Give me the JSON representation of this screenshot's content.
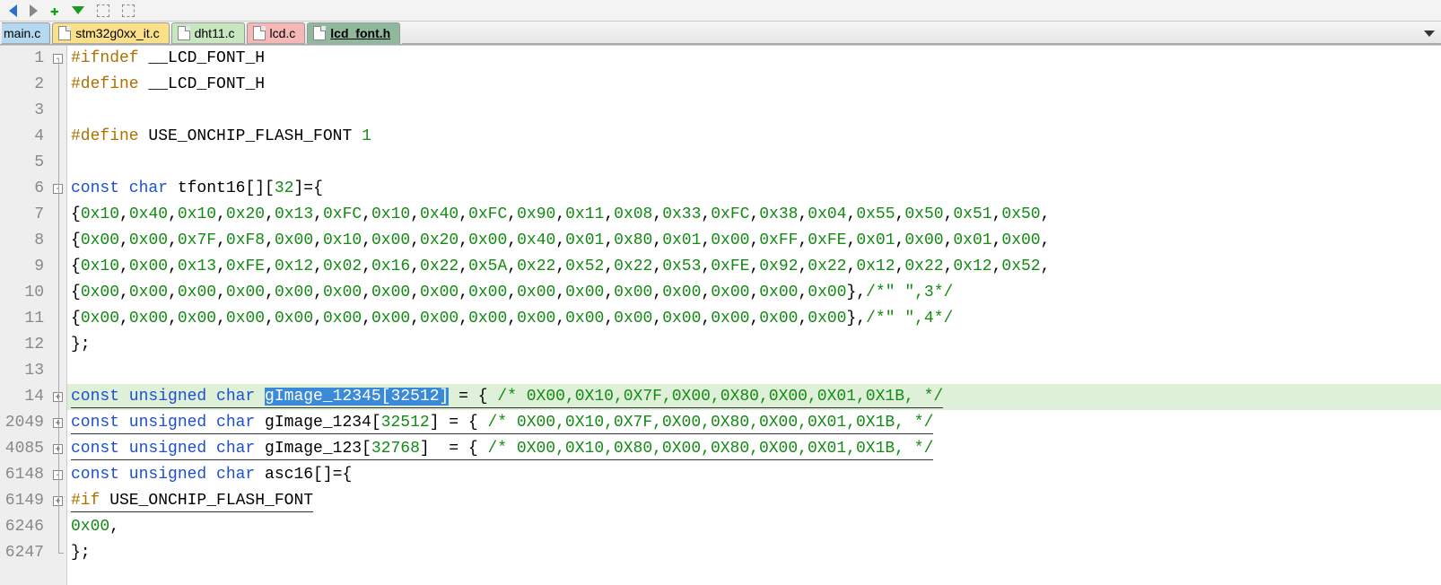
{
  "tabs": [
    {
      "label": "main.c"
    },
    {
      "label": "stm32g0xx_it.c"
    },
    {
      "label": "dht11.c"
    },
    {
      "label": "lcd.c"
    },
    {
      "label": "lcd_font.h"
    }
  ],
  "code": {
    "lines": [
      {
        "n": "1",
        "fold": "minus",
        "foldline": "start",
        "segs": [
          {
            "c": "pp",
            "t": "#ifndef"
          },
          {
            "c": "pun",
            "t": " __LCD_FONT_H"
          }
        ]
      },
      {
        "n": "2",
        "fold": "",
        "foldline": "mid",
        "segs": [
          {
            "c": "pp",
            "t": "#define"
          },
          {
            "c": "pun",
            "t": " __LCD_FONT_H"
          }
        ]
      },
      {
        "n": "3",
        "fold": "",
        "foldline": "mid",
        "segs": [
          {
            "c": "pun",
            "t": ""
          }
        ]
      },
      {
        "n": "4",
        "fold": "",
        "foldline": "mid",
        "segs": [
          {
            "c": "pp",
            "t": "#define"
          },
          {
            "c": "pun",
            "t": " USE_ONCHIP_FLASH_FONT "
          },
          {
            "c": "hex",
            "t": "1"
          }
        ]
      },
      {
        "n": "5",
        "fold": "",
        "foldline": "mid",
        "segs": [
          {
            "c": "pun",
            "t": ""
          }
        ]
      },
      {
        "n": "6",
        "fold": "minus",
        "foldline": "mid",
        "segs": [
          {
            "c": "kw",
            "t": "const char"
          },
          {
            "c": "pun",
            "t": " tfont16[]["
          },
          {
            "c": "hex",
            "t": "32"
          },
          {
            "c": "pun",
            "t": "]={"
          }
        ]
      },
      {
        "n": "7",
        "fold": "",
        "foldline": "mid",
        "segs": [
          {
            "c": "pun",
            "t": "{"
          },
          {
            "c": "hex",
            "t": "0x10"
          },
          {
            "c": "pun",
            "t": ","
          },
          {
            "c": "hex",
            "t": "0x40"
          },
          {
            "c": "pun",
            "t": ","
          },
          {
            "c": "hex",
            "t": "0x10"
          },
          {
            "c": "pun",
            "t": ","
          },
          {
            "c": "hex",
            "t": "0x20"
          },
          {
            "c": "pun",
            "t": ","
          },
          {
            "c": "hex",
            "t": "0x13"
          },
          {
            "c": "pun",
            "t": ","
          },
          {
            "c": "hex",
            "t": "0xFC"
          },
          {
            "c": "pun",
            "t": ","
          },
          {
            "c": "hex",
            "t": "0x10"
          },
          {
            "c": "pun",
            "t": ","
          },
          {
            "c": "hex",
            "t": "0x40"
          },
          {
            "c": "pun",
            "t": ","
          },
          {
            "c": "hex",
            "t": "0xFC"
          },
          {
            "c": "pun",
            "t": ","
          },
          {
            "c": "hex",
            "t": "0x90"
          },
          {
            "c": "pun",
            "t": ","
          },
          {
            "c": "hex",
            "t": "0x11"
          },
          {
            "c": "pun",
            "t": ","
          },
          {
            "c": "hex",
            "t": "0x08"
          },
          {
            "c": "pun",
            "t": ","
          },
          {
            "c": "hex",
            "t": "0x33"
          },
          {
            "c": "pun",
            "t": ","
          },
          {
            "c": "hex",
            "t": "0xFC"
          },
          {
            "c": "pun",
            "t": ","
          },
          {
            "c": "hex",
            "t": "0x38"
          },
          {
            "c": "pun",
            "t": ","
          },
          {
            "c": "hex",
            "t": "0x04"
          },
          {
            "c": "pun",
            "t": ","
          },
          {
            "c": "hex",
            "t": "0x55"
          },
          {
            "c": "pun",
            "t": ","
          },
          {
            "c": "hex",
            "t": "0x50"
          },
          {
            "c": "pun",
            "t": ","
          },
          {
            "c": "hex",
            "t": "0x51"
          },
          {
            "c": "pun",
            "t": ","
          },
          {
            "c": "hex",
            "t": "0x50"
          },
          {
            "c": "pun",
            "t": ","
          }
        ]
      },
      {
        "n": "8",
        "fold": "",
        "foldline": "mid",
        "segs": [
          {
            "c": "pun",
            "t": "{"
          },
          {
            "c": "hex",
            "t": "0x00"
          },
          {
            "c": "pun",
            "t": ","
          },
          {
            "c": "hex",
            "t": "0x00"
          },
          {
            "c": "pun",
            "t": ","
          },
          {
            "c": "hex",
            "t": "0x7F"
          },
          {
            "c": "pun",
            "t": ","
          },
          {
            "c": "hex",
            "t": "0xF8"
          },
          {
            "c": "pun",
            "t": ","
          },
          {
            "c": "hex",
            "t": "0x00"
          },
          {
            "c": "pun",
            "t": ","
          },
          {
            "c": "hex",
            "t": "0x10"
          },
          {
            "c": "pun",
            "t": ","
          },
          {
            "c": "hex",
            "t": "0x00"
          },
          {
            "c": "pun",
            "t": ","
          },
          {
            "c": "hex",
            "t": "0x20"
          },
          {
            "c": "pun",
            "t": ","
          },
          {
            "c": "hex",
            "t": "0x00"
          },
          {
            "c": "pun",
            "t": ","
          },
          {
            "c": "hex",
            "t": "0x40"
          },
          {
            "c": "pun",
            "t": ","
          },
          {
            "c": "hex",
            "t": "0x01"
          },
          {
            "c": "pun",
            "t": ","
          },
          {
            "c": "hex",
            "t": "0x80"
          },
          {
            "c": "pun",
            "t": ","
          },
          {
            "c": "hex",
            "t": "0x01"
          },
          {
            "c": "pun",
            "t": ","
          },
          {
            "c": "hex",
            "t": "0x00"
          },
          {
            "c": "pun",
            "t": ","
          },
          {
            "c": "hex",
            "t": "0xFF"
          },
          {
            "c": "pun",
            "t": ","
          },
          {
            "c": "hex",
            "t": "0xFE"
          },
          {
            "c": "pun",
            "t": ","
          },
          {
            "c": "hex",
            "t": "0x01"
          },
          {
            "c": "pun",
            "t": ","
          },
          {
            "c": "hex",
            "t": "0x00"
          },
          {
            "c": "pun",
            "t": ","
          },
          {
            "c": "hex",
            "t": "0x01"
          },
          {
            "c": "pun",
            "t": ","
          },
          {
            "c": "hex",
            "t": "0x00"
          },
          {
            "c": "pun",
            "t": ","
          }
        ]
      },
      {
        "n": "9",
        "fold": "",
        "foldline": "mid",
        "segs": [
          {
            "c": "pun",
            "t": "{"
          },
          {
            "c": "hex",
            "t": "0x10"
          },
          {
            "c": "pun",
            "t": ","
          },
          {
            "c": "hex",
            "t": "0x00"
          },
          {
            "c": "pun",
            "t": ","
          },
          {
            "c": "hex",
            "t": "0x13"
          },
          {
            "c": "pun",
            "t": ","
          },
          {
            "c": "hex",
            "t": "0xFE"
          },
          {
            "c": "pun",
            "t": ","
          },
          {
            "c": "hex",
            "t": "0x12"
          },
          {
            "c": "pun",
            "t": ","
          },
          {
            "c": "hex",
            "t": "0x02"
          },
          {
            "c": "pun",
            "t": ","
          },
          {
            "c": "hex",
            "t": "0x16"
          },
          {
            "c": "pun",
            "t": ","
          },
          {
            "c": "hex",
            "t": "0x22"
          },
          {
            "c": "pun",
            "t": ","
          },
          {
            "c": "hex",
            "t": "0x5A"
          },
          {
            "c": "pun",
            "t": ","
          },
          {
            "c": "hex",
            "t": "0x22"
          },
          {
            "c": "pun",
            "t": ","
          },
          {
            "c": "hex",
            "t": "0x52"
          },
          {
            "c": "pun",
            "t": ","
          },
          {
            "c": "hex",
            "t": "0x22"
          },
          {
            "c": "pun",
            "t": ","
          },
          {
            "c": "hex",
            "t": "0x53"
          },
          {
            "c": "pun",
            "t": ","
          },
          {
            "c": "hex",
            "t": "0xFE"
          },
          {
            "c": "pun",
            "t": ","
          },
          {
            "c": "hex",
            "t": "0x92"
          },
          {
            "c": "pun",
            "t": ","
          },
          {
            "c": "hex",
            "t": "0x22"
          },
          {
            "c": "pun",
            "t": ","
          },
          {
            "c": "hex",
            "t": "0x12"
          },
          {
            "c": "pun",
            "t": ","
          },
          {
            "c": "hex",
            "t": "0x22"
          },
          {
            "c": "pun",
            "t": ","
          },
          {
            "c": "hex",
            "t": "0x12"
          },
          {
            "c": "pun",
            "t": ","
          },
          {
            "c": "hex",
            "t": "0x52"
          },
          {
            "c": "pun",
            "t": ","
          }
        ]
      },
      {
        "n": "10",
        "fold": "",
        "foldline": "mid",
        "segs": [
          {
            "c": "pun",
            "t": "{"
          },
          {
            "c": "hex",
            "t": "0x00"
          },
          {
            "c": "pun",
            "t": ","
          },
          {
            "c": "hex",
            "t": "0x00"
          },
          {
            "c": "pun",
            "t": ","
          },
          {
            "c": "hex",
            "t": "0x00"
          },
          {
            "c": "pun",
            "t": ","
          },
          {
            "c": "hex",
            "t": "0x00"
          },
          {
            "c": "pun",
            "t": ","
          },
          {
            "c": "hex",
            "t": "0x00"
          },
          {
            "c": "pun",
            "t": ","
          },
          {
            "c": "hex",
            "t": "0x00"
          },
          {
            "c": "pun",
            "t": ","
          },
          {
            "c": "hex",
            "t": "0x00"
          },
          {
            "c": "pun",
            "t": ","
          },
          {
            "c": "hex",
            "t": "0x00"
          },
          {
            "c": "pun",
            "t": ","
          },
          {
            "c": "hex",
            "t": "0x00"
          },
          {
            "c": "pun",
            "t": ","
          },
          {
            "c": "hex",
            "t": "0x00"
          },
          {
            "c": "pun",
            "t": ","
          },
          {
            "c": "hex",
            "t": "0x00"
          },
          {
            "c": "pun",
            "t": ","
          },
          {
            "c": "hex",
            "t": "0x00"
          },
          {
            "c": "pun",
            "t": ","
          },
          {
            "c": "hex",
            "t": "0x00"
          },
          {
            "c": "pun",
            "t": ","
          },
          {
            "c": "hex",
            "t": "0x00"
          },
          {
            "c": "pun",
            "t": ","
          },
          {
            "c": "hex",
            "t": "0x00"
          },
          {
            "c": "pun",
            "t": ","
          },
          {
            "c": "hex",
            "t": "0x00"
          },
          {
            "c": "pun",
            "t": "},"
          },
          {
            "c": "cm",
            "t": "/*\" \",3*/"
          }
        ]
      },
      {
        "n": "11",
        "fold": "",
        "foldline": "mid",
        "segs": [
          {
            "c": "pun",
            "t": "{"
          },
          {
            "c": "hex",
            "t": "0x00"
          },
          {
            "c": "pun",
            "t": ","
          },
          {
            "c": "hex",
            "t": "0x00"
          },
          {
            "c": "pun",
            "t": ","
          },
          {
            "c": "hex",
            "t": "0x00"
          },
          {
            "c": "pun",
            "t": ","
          },
          {
            "c": "hex",
            "t": "0x00"
          },
          {
            "c": "pun",
            "t": ","
          },
          {
            "c": "hex",
            "t": "0x00"
          },
          {
            "c": "pun",
            "t": ","
          },
          {
            "c": "hex",
            "t": "0x00"
          },
          {
            "c": "pun",
            "t": ","
          },
          {
            "c": "hex",
            "t": "0x00"
          },
          {
            "c": "pun",
            "t": ","
          },
          {
            "c": "hex",
            "t": "0x00"
          },
          {
            "c": "pun",
            "t": ","
          },
          {
            "c": "hex",
            "t": "0x00"
          },
          {
            "c": "pun",
            "t": ","
          },
          {
            "c": "hex",
            "t": "0x00"
          },
          {
            "c": "pun",
            "t": ","
          },
          {
            "c": "hex",
            "t": "0x00"
          },
          {
            "c": "pun",
            "t": ","
          },
          {
            "c": "hex",
            "t": "0x00"
          },
          {
            "c": "pun",
            "t": ","
          },
          {
            "c": "hex",
            "t": "0x00"
          },
          {
            "c": "pun",
            "t": ","
          },
          {
            "c": "hex",
            "t": "0x00"
          },
          {
            "c": "pun",
            "t": ","
          },
          {
            "c": "hex",
            "t": "0x00"
          },
          {
            "c": "pun",
            "t": ","
          },
          {
            "c": "hex",
            "t": "0x00"
          },
          {
            "c": "pun",
            "t": "},"
          },
          {
            "c": "cm",
            "t": "/*\" \",4*/"
          }
        ]
      },
      {
        "n": "12",
        "fold": "",
        "foldline": "mid",
        "segs": [
          {
            "c": "pun",
            "t": "};"
          }
        ]
      },
      {
        "n": "13",
        "fold": "",
        "foldline": "mid",
        "segs": [
          {
            "c": "pun",
            "t": ""
          }
        ]
      },
      {
        "n": "14",
        "fold": "plus",
        "foldline": "mid",
        "hl": true,
        "u": true,
        "segs": [
          {
            "c": "kw",
            "t": "const unsigned char"
          },
          {
            "c": "pun",
            "t": " "
          },
          {
            "c": "id",
            "t": "gImage_12345",
            "sel": true
          },
          {
            "c": "pun",
            "t": "[",
            "sel": true
          },
          {
            "c": "hex",
            "t": "32512",
            "sel": true
          },
          {
            "c": "pun",
            "t": "]",
            "sel": true
          },
          {
            "c": "pun",
            "t": " = { "
          },
          {
            "c": "cm",
            "t": "/* 0X00,0X10,0X7F,0X00,0X80,0X00,0X01,0X1B, */"
          }
        ]
      },
      {
        "n": "2049",
        "fold": "plus",
        "foldline": "mid",
        "u": true,
        "segs": [
          {
            "c": "kw",
            "t": "const unsigned char"
          },
          {
            "c": "pun",
            "t": " gImage_1234["
          },
          {
            "c": "hex",
            "t": "32512"
          },
          {
            "c": "pun",
            "t": "] = { "
          },
          {
            "c": "cm",
            "t": "/* 0X00,0X10,0X7F,0X00,0X80,0X00,0X01,0X1B, */"
          }
        ]
      },
      {
        "n": "4085",
        "fold": "plus",
        "foldline": "mid",
        "u": true,
        "segs": [
          {
            "c": "kw",
            "t": "const unsigned char"
          },
          {
            "c": "pun",
            "t": " gImage_123["
          },
          {
            "c": "hex",
            "t": "32768"
          },
          {
            "c": "pun",
            "t": "]  = { "
          },
          {
            "c": "cm",
            "t": "/* 0X00,0X10,0X80,0X00,0X80,0X00,0X01,0X1B, */"
          }
        ]
      },
      {
        "n": "6148",
        "fold": "minus",
        "foldline": "mid",
        "segs": [
          {
            "c": "kw",
            "t": "const unsigned char"
          },
          {
            "c": "pun",
            "t": " asc16[]={"
          }
        ]
      },
      {
        "n": "6149",
        "fold": "plus",
        "foldline": "mid",
        "u": true,
        "segs": [
          {
            "c": "pp",
            "t": "#if"
          },
          {
            "c": "pun",
            "t": " USE_ONCHIP_FLASH_FONT"
          }
        ]
      },
      {
        "n": "6246",
        "fold": "",
        "foldline": "mid",
        "segs": [
          {
            "c": "hex",
            "t": "0x00"
          },
          {
            "c": "pun",
            "t": ","
          }
        ]
      },
      {
        "n": "6247",
        "fold": "",
        "foldline": "end",
        "segs": [
          {
            "c": "pun",
            "t": "};"
          }
        ]
      }
    ]
  }
}
